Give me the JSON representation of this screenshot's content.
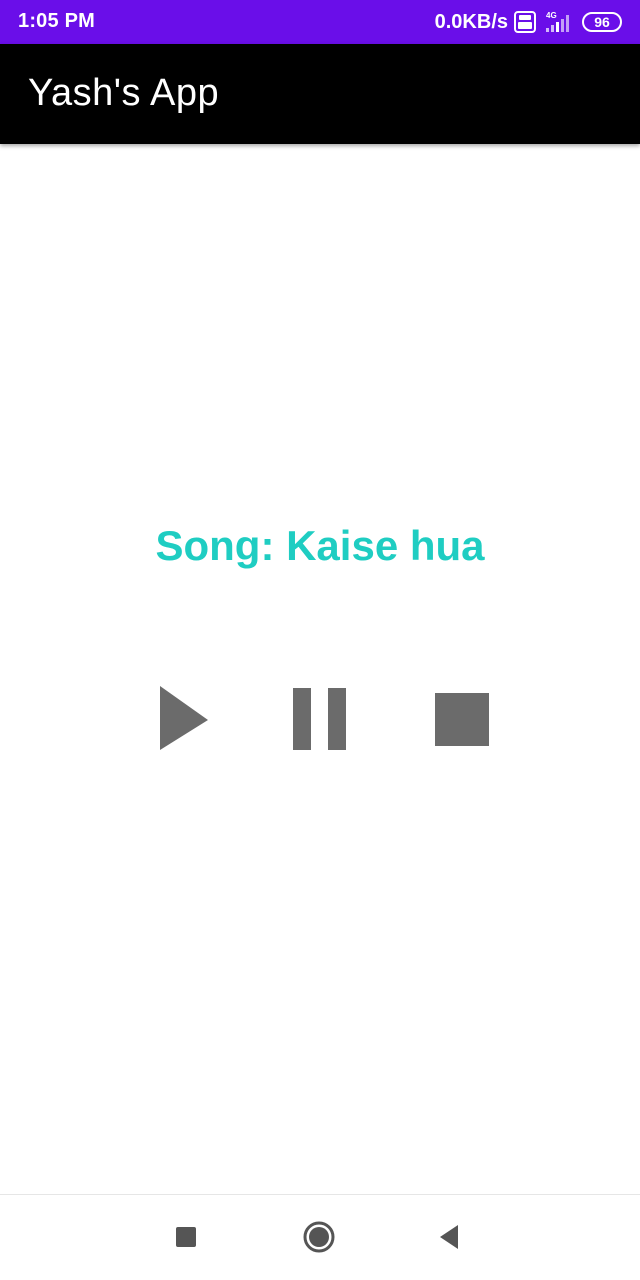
{
  "status_bar": {
    "time": "1:05 PM",
    "net_speed": "0.0KB/s",
    "network_type": "4G",
    "battery_level": "96",
    "background_color": "#6a0ee9"
  },
  "app_bar": {
    "title": "Yash's App",
    "background_color": "#000000"
  },
  "player": {
    "song_label": "Song: Kaise hua",
    "song_color": "#1fcdc2",
    "controls": [
      {
        "name": "play",
        "icon": "play-icon"
      },
      {
        "name": "pause",
        "icon": "pause-icon"
      },
      {
        "name": "stop",
        "icon": "stop-icon"
      }
    ],
    "control_color": "#6b6b6b"
  },
  "nav_bar": {
    "buttons": [
      "recents-icon",
      "home-icon",
      "back-icon"
    ]
  }
}
